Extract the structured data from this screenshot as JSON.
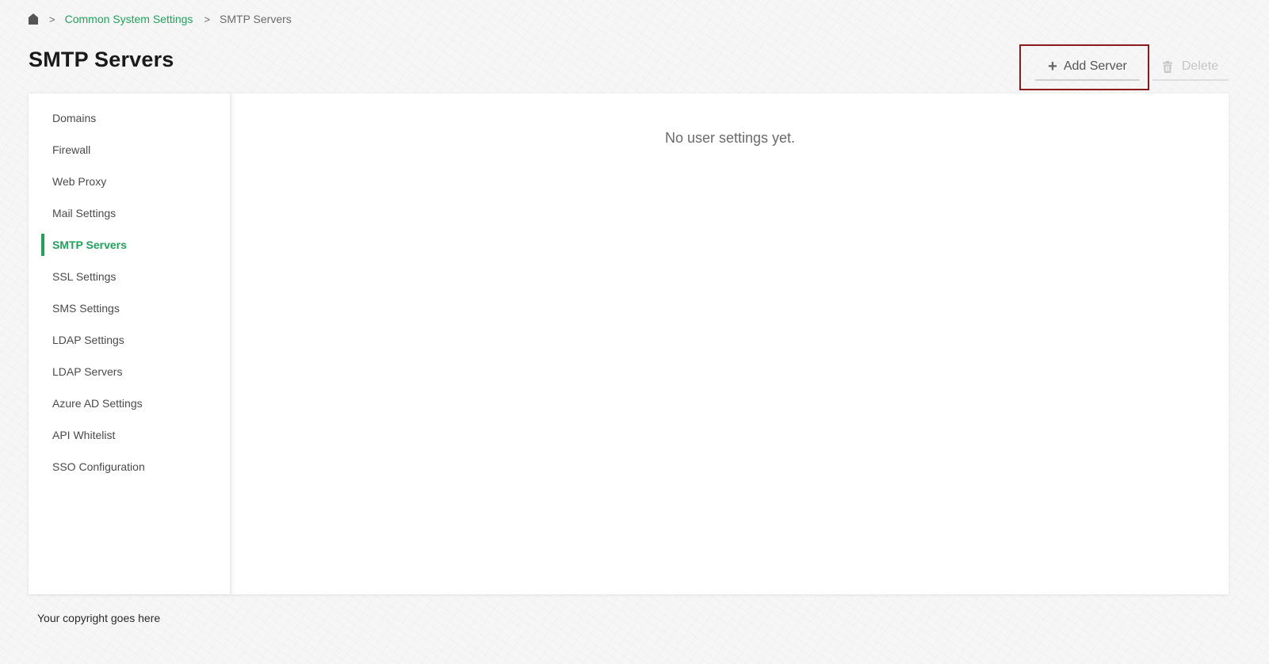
{
  "breadcrumb": {
    "home_icon": "home-icon",
    "separator": ">",
    "items": [
      {
        "label": "Common System Settings"
      },
      {
        "label": "SMTP Servers"
      }
    ]
  },
  "page": {
    "title": "SMTP Servers"
  },
  "toolbar": {
    "add_label": "Add Server",
    "add_icon": "plus-icon",
    "delete_label": "Delete",
    "delete_icon": "trash-icon"
  },
  "sidebar": {
    "active_index": 4,
    "items": [
      {
        "label": "Domains"
      },
      {
        "label": "Firewall"
      },
      {
        "label": "Web Proxy"
      },
      {
        "label": "Mail Settings"
      },
      {
        "label": "SMTP Servers"
      },
      {
        "label": "SSL Settings"
      },
      {
        "label": "SMS Settings"
      },
      {
        "label": "LDAP Settings"
      },
      {
        "label": "LDAP Servers"
      },
      {
        "label": "Azure AD Settings"
      },
      {
        "label": "API Whitelist"
      },
      {
        "label": "SSO Configuration"
      }
    ]
  },
  "main": {
    "empty_message": "No user settings yet."
  },
  "footer": {
    "copyright": "Your copyright goes here"
  },
  "colors": {
    "accent": "#1fa35b",
    "highlight_border": "#8b1a1a",
    "disabled_text": "#c6c6c6"
  }
}
